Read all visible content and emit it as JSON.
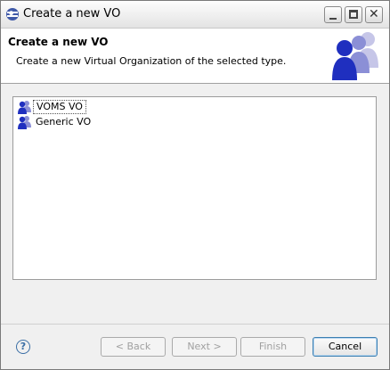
{
  "window": {
    "title": "Create a new VO"
  },
  "header": {
    "title": "Create a new VO",
    "description": "Create a new Virtual Organization of the selected type."
  },
  "list": {
    "items": [
      {
        "label": "VOMS VO",
        "selected": true,
        "icon": "vo-users-icon"
      },
      {
        "label": "Generic VO",
        "selected": false,
        "icon": "vo-users-icon"
      }
    ]
  },
  "buttons": {
    "back": "< Back",
    "next": "Next >",
    "finish": "Finish",
    "cancel": "Cancel"
  },
  "colors": {
    "accent": "#3c7fb1",
    "icon_blue": "#1f2fbf",
    "disabled_text": "#a0a0a0"
  }
}
